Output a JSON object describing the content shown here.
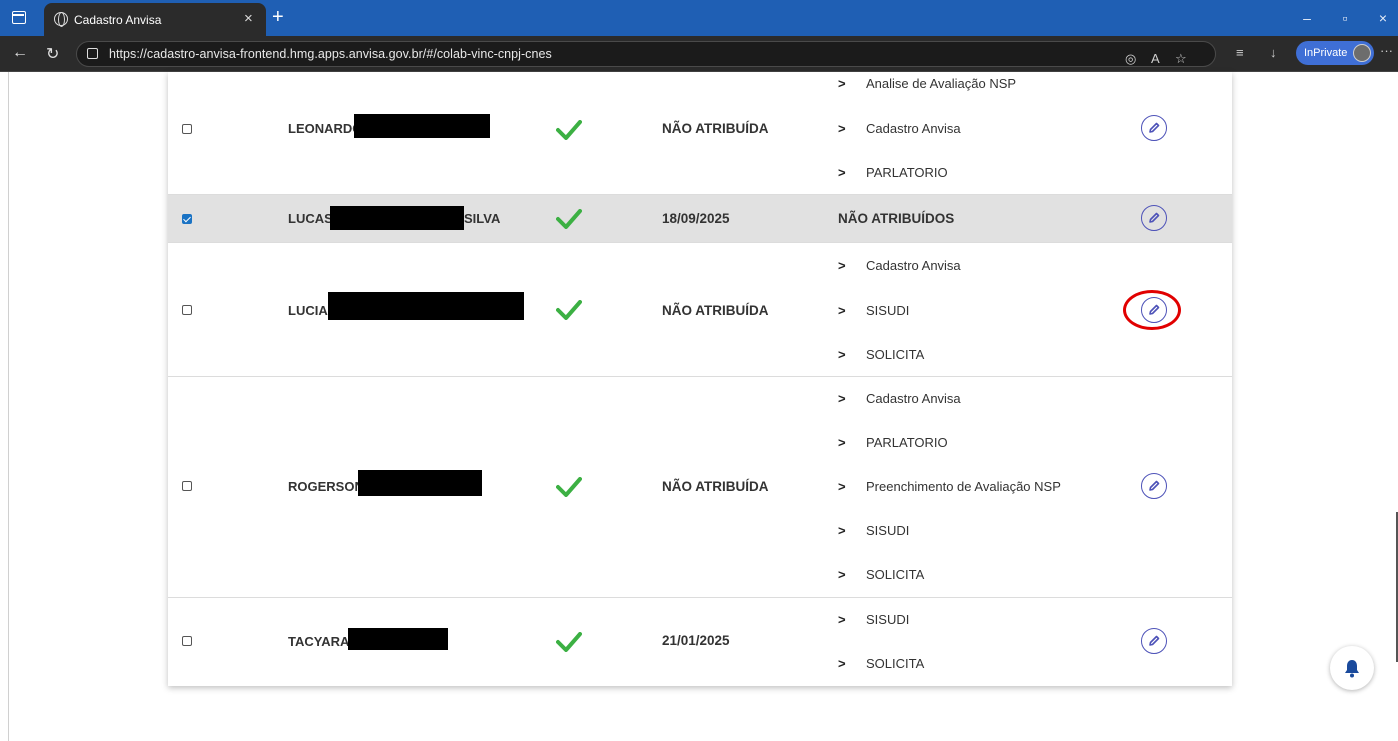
{
  "browser": {
    "tab_title": "Cadastro Anvisa",
    "tab_close": "×",
    "new_tab": "+",
    "url": "https://cadastro-anvisa-frontend.hmg.apps.anvisa.gov.br/#/colab-vinc-cnpj-cnes",
    "inprivate_label": "InPrivate",
    "minimize": "–",
    "restore": "▫",
    "close": "×",
    "more": "···"
  },
  "table": {
    "rows": [
      {
        "checked": false,
        "name_prefix": "LEONARDO",
        "name_suffix": "",
        "active": true,
        "date": "NÃO ATRIBUÍDA",
        "permissions": [
          "Analise de Avaliação NSP",
          "Cadastro Anvisa",
          "PARLATORIO"
        ],
        "no_permissions_label": ""
      },
      {
        "checked": true,
        "name_prefix": "LUCAS",
        "name_suffix": "SILVA",
        "active": true,
        "date": "18/09/2025",
        "permissions": [],
        "no_permissions_label": "NÃO ATRIBUÍDOS"
      },
      {
        "checked": false,
        "name_prefix": "LUCIA",
        "name_suffix": "",
        "active": true,
        "date": "NÃO ATRIBUÍDA",
        "permissions": [
          "Cadastro Anvisa",
          "SISUDI",
          "SOLICITA"
        ],
        "no_permissions_label": "",
        "highlighted": true
      },
      {
        "checked": false,
        "name_prefix": "ROGERSON",
        "name_suffix": "",
        "active": true,
        "date": "NÃO ATRIBUÍDA",
        "permissions": [
          "Cadastro Anvisa",
          "PARLATORIO",
          "Preenchimento de Avaliação NSP",
          "SISUDI",
          "SOLICITA"
        ],
        "no_permissions_label": ""
      },
      {
        "checked": false,
        "name_prefix": "TACYARA",
        "name_suffix": "",
        "active": true,
        "date": "21/01/2025",
        "permissions": [
          "SISUDI",
          "SOLICITA"
        ],
        "no_permissions_label": ""
      }
    ]
  },
  "colors": {
    "accent": "#4d52b8",
    "check_green": "#3cb043",
    "highlight_red": "#e10000",
    "selected_row": "#e1e1e1",
    "tabbar": "#1f5fb4"
  },
  "icons": {
    "edit": "pencil-circle-icon",
    "active": "checkmark-icon",
    "expand": "chevron-right-icon",
    "notifications": "bell-icon"
  }
}
